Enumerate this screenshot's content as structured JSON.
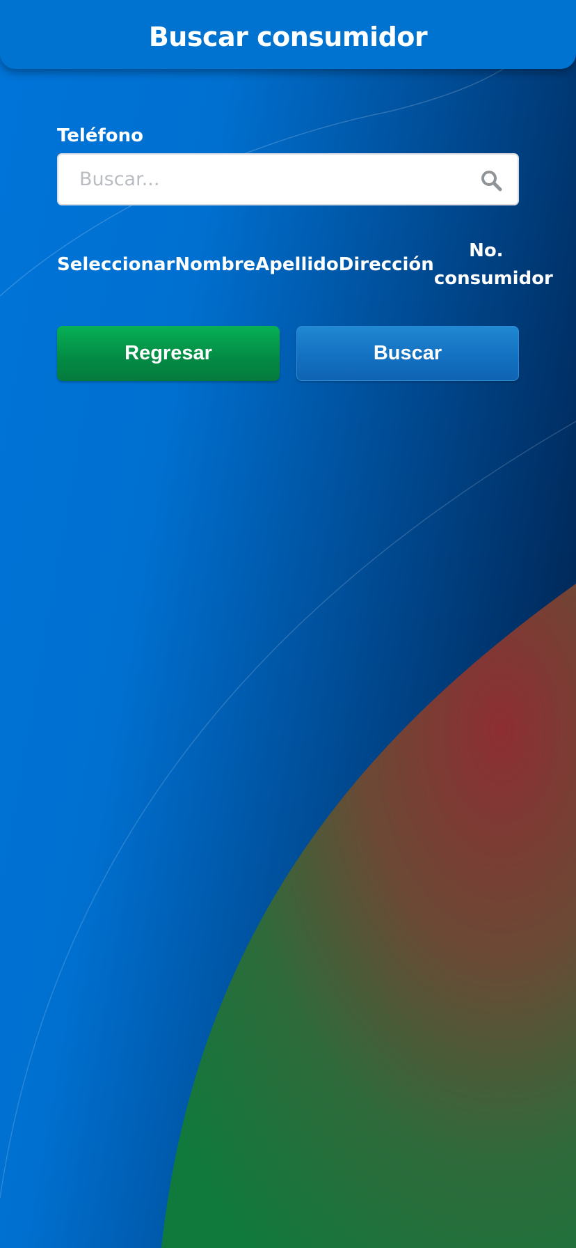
{
  "header": {
    "title": "Buscar consumidor"
  },
  "form": {
    "phone_label": "Teléfono",
    "search_placeholder": "Buscar...",
    "search_value": "",
    "search_icon": "search-icon"
  },
  "table": {
    "columns": [
      "Seleccionar",
      "Nombre",
      "Apellido",
      "Dirección",
      "No. consumidor"
    ]
  },
  "buttons": {
    "back_label": "Regresar",
    "search_label": "Buscar"
  },
  "colors": {
    "header": "#0072d0",
    "back_button": "#049a4c",
    "search_button": "#1a7dca",
    "background_blue": "#0074d9",
    "background_dark": "#001a3a",
    "accent_red": "#8a2e30",
    "accent_green": "#127a3c"
  }
}
